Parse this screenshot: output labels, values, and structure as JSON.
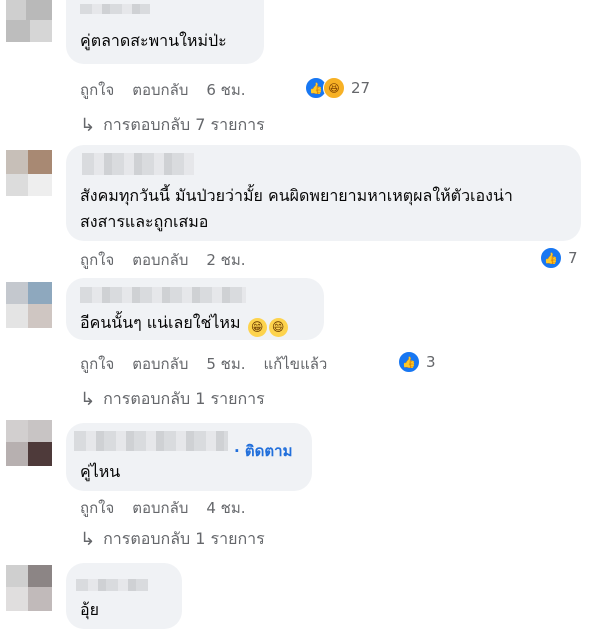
{
  "comments": [
    {
      "text_lines": [
        "คู่ตลาดสะพานใหม่ป่ะ"
      ],
      "actions": {
        "like": "ถูกใจ",
        "reply": "ตอบกลับ",
        "time": "6 ชม."
      },
      "reaction_count": "27",
      "replies_label": "การตอบกลับ 7 รายการ"
    },
    {
      "text_lines": [
        "สังคมทุกวันนี้ มันป่วยว่ามั้ย คนผิดพยายามหาเหตุผลให้ตัวเองน่า",
        "สงสารและถูกเสมอ"
      ],
      "actions": {
        "like": "ถูกใจ",
        "reply": "ตอบกลับ",
        "time": "2 ชม."
      },
      "reaction_count": "7"
    },
    {
      "text_lines": [
        "อีคนนั้นๆ แน่เลยใช่ไหม"
      ],
      "actions": {
        "like": "ถูกใจ",
        "reply": "ตอบกลับ",
        "time": "5 ชม.",
        "edited": "แก้ไขแล้ว"
      },
      "reaction_count": "3",
      "replies_label": "การตอบกลับ 1 รายการ"
    },
    {
      "follow_label": "· ติดตาม",
      "text_lines": [
        "คู่ไหน"
      ],
      "actions": {
        "like": "ถูกใจ",
        "reply": "ตอบกลับ",
        "time": "4 ชม."
      },
      "replies_label": "การตอบกลับ 1 รายการ"
    },
    {
      "text_lines": [
        "อุ้ย"
      ]
    }
  ],
  "icons": {
    "like": "like-icon",
    "haha": "haha-icon",
    "reply_arrow": "reply-arrow-icon",
    "grin": "grinning-emoji-icon"
  },
  "colors": {
    "bubble": "#f0f2f5",
    "like": "#1877f2",
    "link": "#216fdb",
    "muted": "#65676b"
  }
}
